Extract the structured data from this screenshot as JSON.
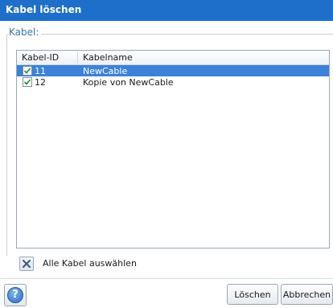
{
  "window": {
    "title": "Kabel löschen"
  },
  "group": {
    "label": "Kabel:"
  },
  "list": {
    "columns": [
      "Kabel-ID",
      "Kabelname"
    ],
    "rows": [
      {
        "id": "11",
        "name": "NewCable",
        "checked": true,
        "selected": true
      },
      {
        "id": "12",
        "name": "Kopie von NewCable",
        "checked": true,
        "selected": false
      }
    ]
  },
  "select_all": {
    "label": "Alle Kabel auswählen"
  },
  "footer": {
    "delete_label": "Löschen",
    "cancel_label": "Abbrechen",
    "help_icon": "?"
  },
  "colors": {
    "titlebar": "#1d6fc9",
    "selection": "#3c82d8",
    "group_label": "#3a73b5"
  }
}
